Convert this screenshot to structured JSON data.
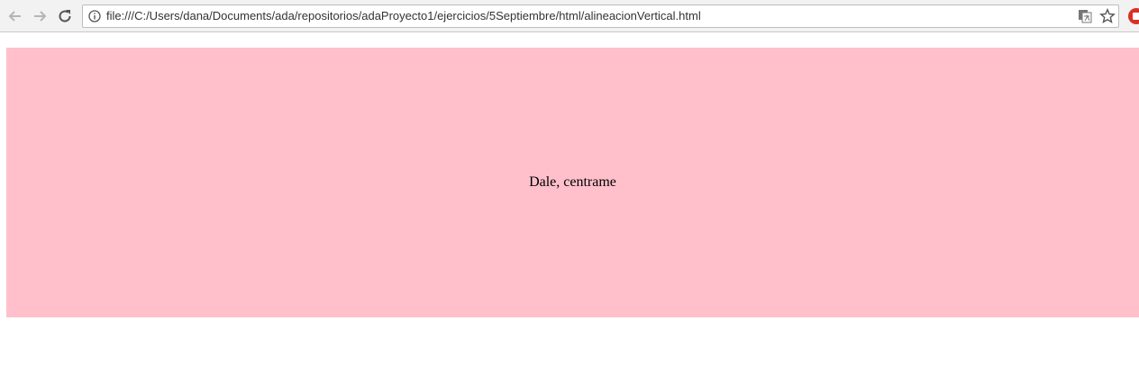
{
  "browser": {
    "url": "file:///C:/Users/dana/Documents/ada/repositorios/adaProyecto1/ejercicios/5Septiembre/html/alineacionVertical.html",
    "icons": {
      "back": "arrow-left-icon",
      "forward": "arrow-right-icon",
      "reload": "reload-icon",
      "info": "info-icon",
      "translate": "translate-icon",
      "bookmark": "star-icon",
      "extension": "extension-icon"
    }
  },
  "page": {
    "box_text": "Dale, centrame",
    "box_color": "#ffc0cb"
  }
}
